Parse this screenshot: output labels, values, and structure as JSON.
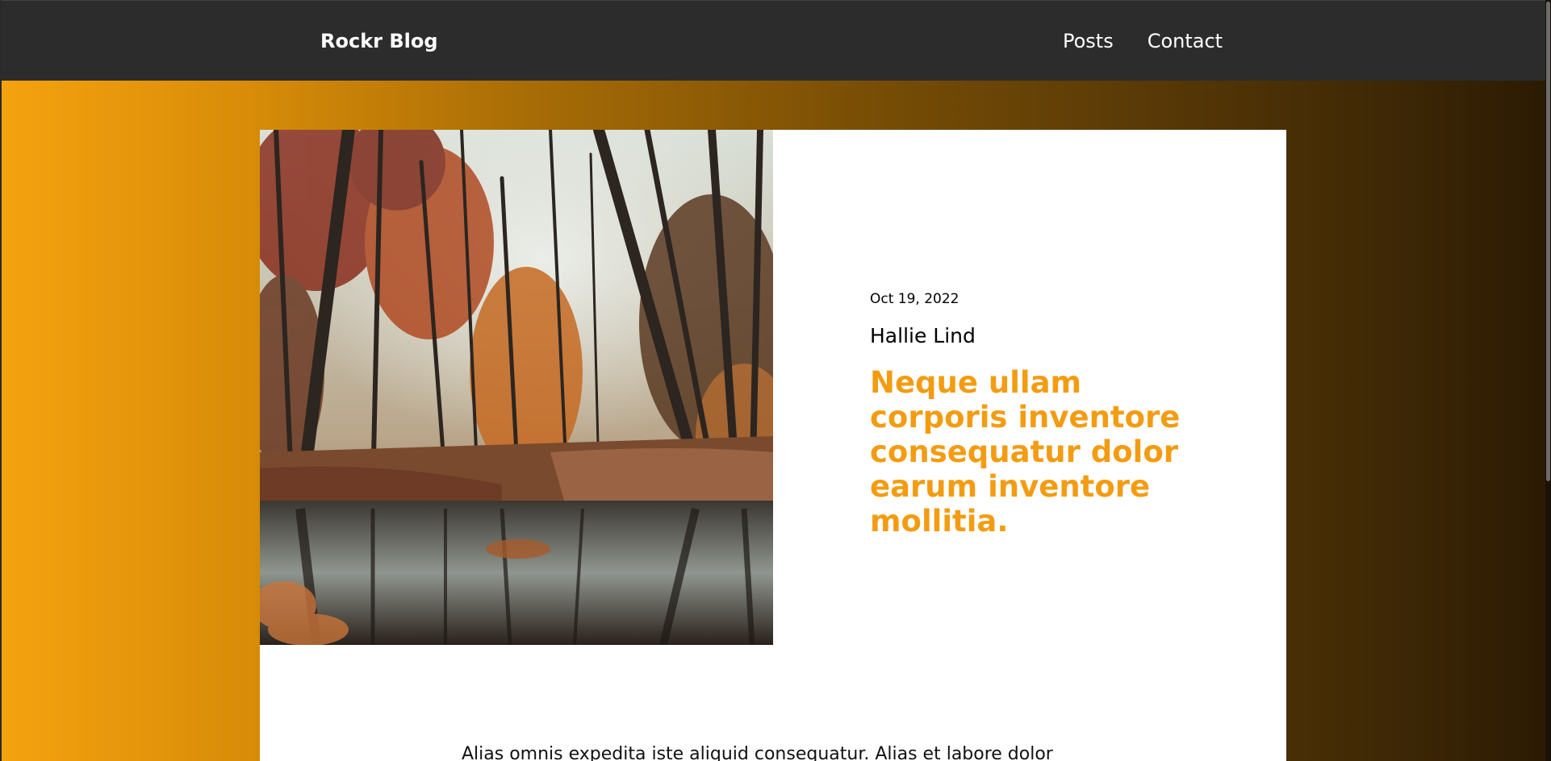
{
  "navbar": {
    "brand": "Rockr Blog",
    "links": [
      {
        "label": "Posts"
      },
      {
        "label": "Contact"
      }
    ]
  },
  "post": {
    "image_alt": "Autumn forest with trees reflected in a still river",
    "date": "Oct 19, 2022",
    "author": "Hallie Lind",
    "title": "Neque ullam corporis inventore consequatur dolor earum inventore mollitia.",
    "body_excerpt": "Alias omnis expedita iste aliquid consequatur. Alias et labore dolor"
  },
  "colors": {
    "accent": "#f39c12",
    "navbar_bg": "#2c2c2c",
    "gradient_start": "#f5a20f",
    "gradient_end": "#2b1a03"
  }
}
